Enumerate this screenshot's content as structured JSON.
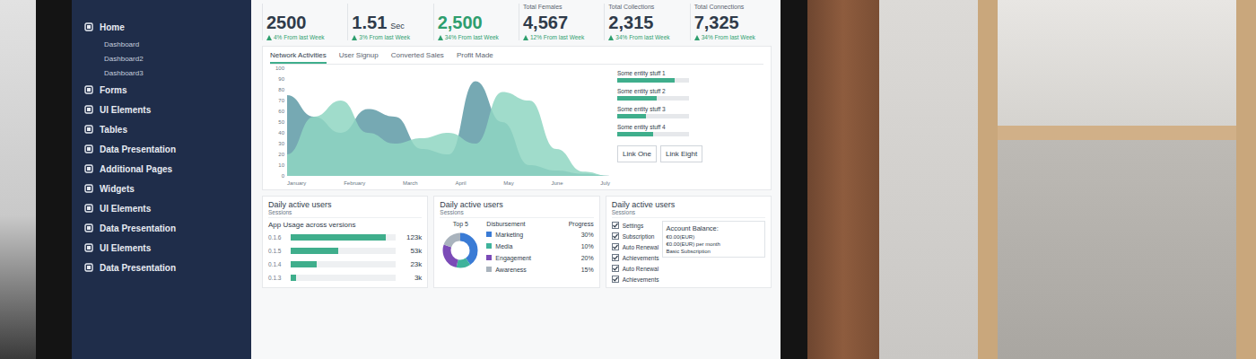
{
  "sidebar": {
    "items": [
      {
        "label": "Home",
        "kind": "section",
        "selected": false
      },
      {
        "label": "Dashboard",
        "kind": "sub",
        "selected": false
      },
      {
        "label": "Dashboard2",
        "kind": "sub",
        "selected": false
      },
      {
        "label": "Dashboard3",
        "kind": "sub",
        "selected": false
      },
      {
        "label": "Forms",
        "kind": "section",
        "selected": false
      },
      {
        "label": "UI Elements",
        "kind": "section",
        "selected": false
      },
      {
        "label": "Tables",
        "kind": "section",
        "selected": false
      },
      {
        "label": "Data Presentation",
        "kind": "section",
        "selected": false
      },
      {
        "label": "Additional Pages",
        "kind": "section",
        "selected": false
      },
      {
        "label": "Widgets",
        "kind": "section",
        "selected": false
      },
      {
        "label": "UI Elements",
        "kind": "section",
        "selected": false
      },
      {
        "label": "Data Presentation",
        "kind": "section",
        "selected": false
      },
      {
        "label": "UI Elements",
        "kind": "section",
        "selected": false
      },
      {
        "label": "Data Presentation",
        "kind": "section",
        "selected": false
      }
    ]
  },
  "stats": [
    {
      "value": "2500",
      "delta": "4% From last Week",
      "color": "#2f3b4a"
    },
    {
      "value": "1.51",
      "unit": "Sec",
      "delta": "3% From last Week",
      "color": "#2f3b4a"
    },
    {
      "value": "2,500",
      "delta": "34% From last Week",
      "color": "#2e9e6e"
    },
    {
      "label": "Total Females",
      "value": "4,567",
      "delta": "12% From last Week",
      "color": "#2f3b4a"
    },
    {
      "label": "Total Collections",
      "value": "2,315",
      "delta": "34% From last Week",
      "color": "#2f3b4a"
    },
    {
      "label": "Total Connections",
      "value": "7,325",
      "delta": "34% From last Week",
      "color": "#2f3b4a"
    }
  ],
  "chart": {
    "tabs": [
      {
        "label": "Network Activities",
        "selected": true
      },
      {
        "label": "User Signup",
        "selected": false
      },
      {
        "label": "Converted Sales",
        "selected": false
      },
      {
        "label": "Profit Made",
        "selected": false
      }
    ],
    "y_ticks": [
      "100",
      "90",
      "80",
      "70",
      "60",
      "50",
      "40",
      "30",
      "20",
      "10",
      "0"
    ],
    "x_labels": [
      "January",
      "February",
      "March",
      "April",
      "May",
      "June",
      "July"
    ],
    "series": [
      {
        "values": [
          75,
          55,
          40,
          62,
          55,
          25,
          20,
          88,
          50,
          10,
          5,
          2,
          0
        ],
        "color": "#5e9aa6"
      },
      {
        "values": [
          20,
          55,
          70,
          40,
          30,
          35,
          40,
          30,
          78,
          70,
          25,
          4,
          0
        ],
        "color": "#8fd6c2"
      }
    ],
    "progress": [
      {
        "label": "Some entity stuff 1",
        "level": 0.8
      },
      {
        "label": "Some entity stuff 2",
        "level": 0.55
      },
      {
        "label": "Some entity stuff 3",
        "level": 0.4
      },
      {
        "label": "Some entity stuff 4",
        "level": 0.5
      }
    ],
    "links": [
      "Link One",
      "Link Eight"
    ]
  },
  "cards": {
    "usage": {
      "title": "Daily active users",
      "subtitle": "Sessions",
      "heading": "App Usage across versions",
      "bars": [
        {
          "label": "0.1.6",
          "value": "123k",
          "level": 0.9
        },
        {
          "label": "0.1.5",
          "value": "53k",
          "level": 0.45
        },
        {
          "label": "0.1.4",
          "value": "23k",
          "level": 0.25
        },
        {
          "label": "0.1.3",
          "value": "3k",
          "level": 0.05
        }
      ]
    },
    "disbursement": {
      "title": "Daily active users",
      "subtitle": "Sessions",
      "top": "Top 5",
      "columns": [
        "Disbursement",
        "Progress"
      ],
      "rows": [
        {
          "label": "Marketing",
          "percent": "30%",
          "value": 30,
          "color": "#3a7bd5"
        },
        {
          "label": "Media",
          "percent": "10%",
          "value": 10,
          "color": "#3fb39b"
        },
        {
          "label": "Engagement",
          "percent": "20%",
          "value": 20,
          "color": "#7b4bb7"
        },
        {
          "label": "Awareness",
          "percent": "15%",
          "value": 15,
          "color": "#a9b3bd"
        }
      ]
    },
    "account": {
      "title": "Daily active users",
      "subtitle": "Sessions",
      "checklist": [
        {
          "label": "Settings",
          "checked": true
        },
        {
          "label": "Subscription",
          "checked": true
        },
        {
          "label": "Auto Renewal",
          "checked": true
        },
        {
          "label": "Achievements",
          "checked": true
        },
        {
          "label": "Auto Renewal",
          "checked": true
        },
        {
          "label": "Achievements",
          "checked": true
        }
      ],
      "balance": {
        "title": "Account Balance:",
        "amount": "€0.00(EUR)",
        "per_month": "€0.00(EUR) per month",
        "plan": "Basic Subscription"
      }
    }
  }
}
